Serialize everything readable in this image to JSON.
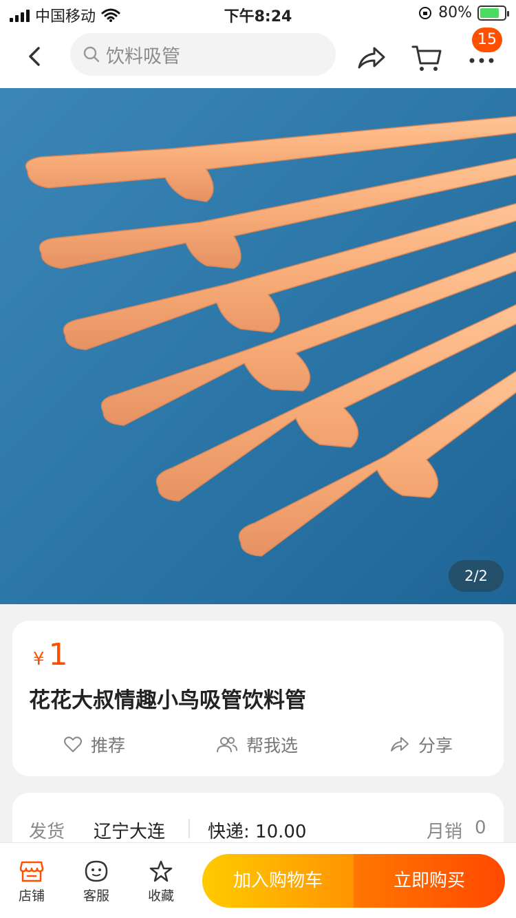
{
  "status_bar": {
    "carrier": "中国移动",
    "time": "下午8:24",
    "battery_percent": "80%",
    "battery_level": 0.8
  },
  "nav": {
    "search_placeholder": "饮料吸管",
    "cart_badge": "15",
    "icons": [
      "chevron-left-icon",
      "search-icon",
      "share-icon",
      "cart-icon",
      "more-icon"
    ]
  },
  "gallery": {
    "page_indicator": "2/2"
  },
  "product": {
    "currency": "¥",
    "price": "1",
    "title": "花花大叔情趣小鸟吸管饮料管",
    "actions": [
      {
        "label": "推荐",
        "icon": "heart-icon"
      },
      {
        "label": "帮我选",
        "icon": "people-icon"
      },
      {
        "label": "分享",
        "icon": "share-icon"
      }
    ]
  },
  "shipping": {
    "label": "发货",
    "origin": "辽宁大连",
    "express": "快递: 10.00",
    "monthly_sales_label": "月销",
    "monthly_sales": "0"
  },
  "bottom_bar": {
    "tabs": [
      {
        "label": "店铺",
        "icon": "store-icon"
      },
      {
        "label": "客服",
        "icon": "service-icon"
      },
      {
        "label": "收藏",
        "icon": "star-icon"
      }
    ],
    "add_to_cart": "加入购物车",
    "buy_now": "立即购买"
  },
  "colors": {
    "accent": "#ff5000",
    "cart_button": "#ffa100",
    "buy_button": "#ff5500",
    "hero_background": "#2f7bab"
  }
}
